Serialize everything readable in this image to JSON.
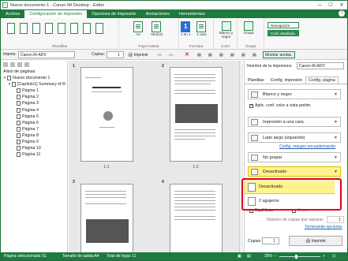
{
  "window": {
    "title": "Nuevo documento 1 - Canon iW Desktop - Editor"
  },
  "tabs": [
    "Archivo",
    "Configuración de impresión",
    "Opciones de impresión",
    "Anotaciones",
    "Herramientas"
  ],
  "ribbon": {
    "groups": {
      "plantillas": "Plantillas",
      "papel_salida": "Papel salida",
      "formato": "Formato",
      "color": "Color",
      "grapa": "Grapa"
    },
    "buttons": {
      "a4": "A4",
      "vertical": "Vertical",
      "uno_en_uno": "1 en 1",
      "una_cara": "1 cara",
      "blanco_negro": "Blanco y negro",
      "grapa": "Grapa"
    },
    "navegacion": "Navegación",
    "conf_detallada": "Conf. detallada"
  },
  "toolbar": {
    "impres_label": "Impres:",
    "printer": "Canon iR-ADV",
    "copias_label": "Copias:",
    "copias_value": "1",
    "imprimir": "Imprimir",
    "mostrar_anotac": "Mostrar anotac."
  },
  "tree": {
    "title": "Árbol de páginas",
    "root": "Nuevo documento 1",
    "child": "[Capítulo1] Summary of R",
    "pages": [
      "Página 1",
      "Página 2",
      "Página 3",
      "Página 4",
      "Página 5",
      "Página 6",
      "Página 7",
      "Página 8",
      "Página 9",
      "Página 10",
      "Página 11"
    ]
  },
  "pages": {
    "numbers": [
      "1",
      "2",
      "3",
      "4"
    ],
    "captions": [
      "1-1",
      "1-2"
    ]
  },
  "right": {
    "printer_label": "Nombre de la impresora:",
    "printer": "Canon iR-ADV",
    "tabs": [
      "Plantillas",
      "Config. impresión",
      "Config. página"
    ],
    "color_mode": "Blanco y negro",
    "aplic_conf": "Aplic. conf. color a vista prelim.",
    "print_mode": "Impresión a una cara",
    "binding": "Lado largo (izquierdo)",
    "config_margen": "Config. margen encuadernación",
    "staple": "No grapar",
    "punch_selected": "Desactivado",
    "punch_options": [
      "Desactivado",
      "2 agujeros"
    ],
    "equil_bear": "Equil bear",
    "crear": "Crear",
    "copias_separar": "Número de copias que separar:",
    "copias_separar_value": "1",
    "terminando": "Terminando opciones",
    "copias_label": "Copias:",
    "copias_value": "1",
    "imprimir": "Imprimir"
  },
  "status": {
    "pagina_sel": "Página seleccionada /11",
    "tamano": "Tamaño de salida:A4",
    "total": "Total de hojas 11",
    "zoom": "25%"
  },
  "colors": {
    "accent": "#1e7a3e",
    "highlight": "#fff38a",
    "callout": "#e0001b"
  }
}
